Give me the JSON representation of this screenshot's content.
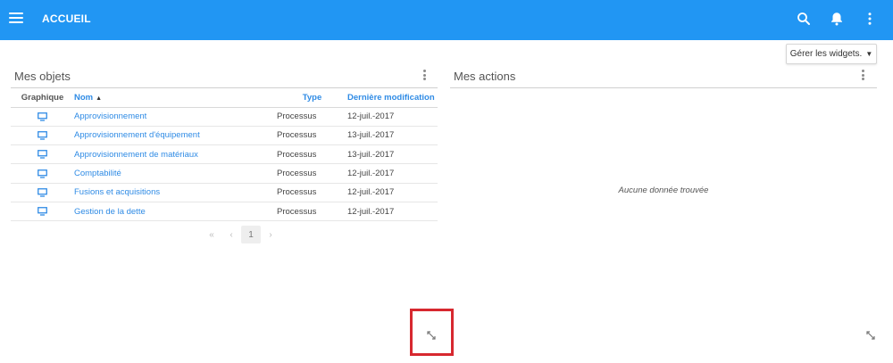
{
  "header": {
    "title": "ACCUEIL",
    "icons": [
      "menu-icon",
      "search-icon",
      "bell-icon",
      "more-vert-icon"
    ],
    "bar_color": "#2196f3"
  },
  "toolbar": {
    "manage_widgets_label": "Gérer les widgets."
  },
  "objects_widget": {
    "title": "Mes objets",
    "columns": {
      "graphic": "Graphique",
      "name": "Nom",
      "type": "Type",
      "modified": "Dernière modification"
    },
    "rows": [
      {
        "name": "Approvisionnement",
        "type": "Processus",
        "date": "12-juil.-2017"
      },
      {
        "name": "Approvisionnement d'équipement",
        "type": "Processus",
        "date": "13-juil.-2017"
      },
      {
        "name": "Approvisionnement de matériaux",
        "type": "Processus",
        "date": "13-juil.-2017"
      },
      {
        "name": "Comptabilité",
        "type": "Processus",
        "date": "12-juil.-2017"
      },
      {
        "name": "Fusions et acquisitions",
        "type": "Processus",
        "date": "12-juil.-2017"
      },
      {
        "name": "Gestion de la dette",
        "type": "Processus",
        "date": "12-juil.-2017"
      }
    ],
    "pagination": {
      "first": "«",
      "prev": "‹",
      "current": "1",
      "next": "›"
    }
  },
  "actions_widget": {
    "title": "Mes actions",
    "empty_text": "Aucune donnée trouvée"
  },
  "colors": {
    "link": "#2f8be5",
    "highlight": "#d7282f"
  }
}
